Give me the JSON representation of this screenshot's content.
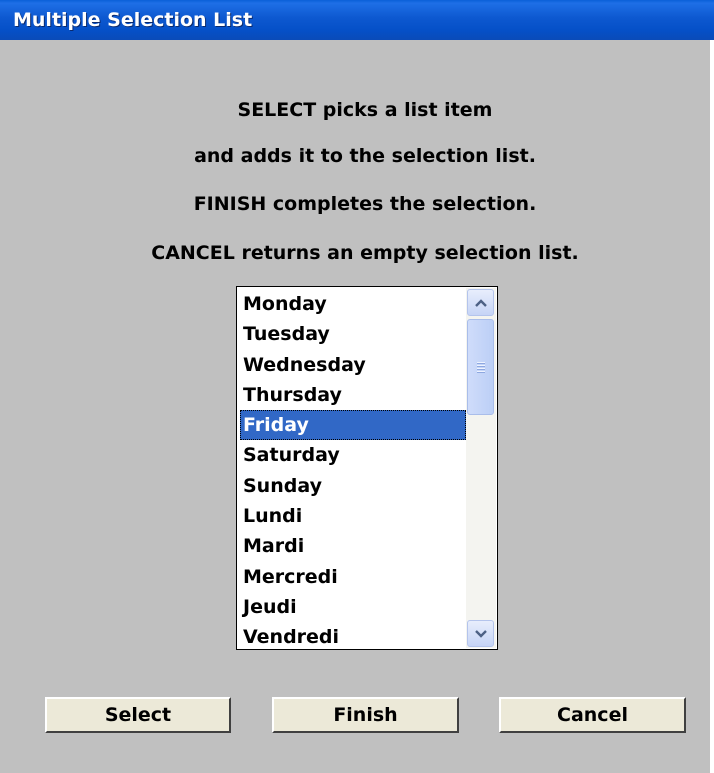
{
  "window": {
    "title": "Multiple Selection List"
  },
  "instructions": [
    "SELECT picks a list item",
    "and adds it to the selection list.",
    "FINISH completes the selection.",
    "CANCEL returns an empty selection list."
  ],
  "list": {
    "items": [
      "Monday",
      "Tuesday",
      "Wednesday",
      "Thursday",
      "Friday",
      "Saturday",
      "Sunday",
      "Lundi",
      "Mardi",
      "Mercredi",
      "Jeudi",
      "Vendredi"
    ],
    "selected": "Friday"
  },
  "buttons": {
    "select": "Select",
    "finish": "Finish",
    "cancel": "Cancel"
  },
  "colors": {
    "titlebar": "#0550c8",
    "dialog_background": "#c0c0c0",
    "selection": "#3168c6",
    "button_face": "#ece9d8"
  },
  "icons": {
    "scroll_up": "chevron-up-icon",
    "scroll_down": "chevron-down-icon"
  }
}
